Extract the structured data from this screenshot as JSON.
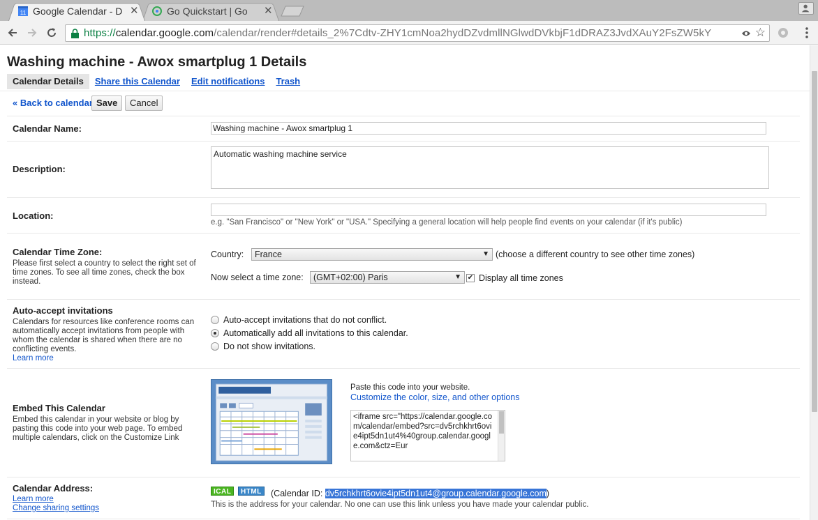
{
  "browser": {
    "tabs": [
      {
        "title": "Google Calendar - D",
        "active": true
      },
      {
        "title": "Go Quickstart  |  Go",
        "active": false
      }
    ],
    "url": {
      "scheme": "https://",
      "host": "calendar.google.com",
      "path": "/calendar/render#details_2%7Cdtv-ZHY1cmNoa2hydDZvdmllNGlwdDVkbjF1dDRAZ3JvdXAuY2FsZW5kY"
    }
  },
  "page": {
    "title": "Washing machine - Awox smartplug 1 Details",
    "tabs": [
      "Calendar Details",
      "Share this Calendar",
      "Edit notifications",
      "Trash"
    ],
    "back_link": "« Back to calendar",
    "save_label": "Save",
    "cancel_label": "Cancel"
  },
  "fields": {
    "name": {
      "label": "Calendar Name:",
      "value": "Washing machine - Awox smartplug 1"
    },
    "description": {
      "label": "Description:",
      "value": "Automatic washing machine service"
    },
    "location": {
      "label": "Location:",
      "value": "",
      "hint": "e.g. \"San Francisco\" or \"New York\" or \"USA.\" Specifying a general location will help people find events on your calendar (if it's public)"
    },
    "timezone": {
      "label": "Calendar Time Zone:",
      "desc": "Please first select a country to select the right set of time zones. To see all time zones, check the box instead.",
      "country_label": "Country:",
      "country_value": "France",
      "country_note": "(choose a different country to see other time zones)",
      "tz_label": "Now select a time zone:",
      "tz_value": "(GMT+02:00) Paris",
      "all_tz_label": "Display all time zones",
      "all_tz_checked": true
    },
    "auto_accept": {
      "label": "Auto-accept invitations",
      "desc": "Calendars for resources like conference rooms can automatically accept invitations from people with whom the calendar is shared when there are no conflicting events.",
      "learn_more": "Learn more",
      "options": [
        "Auto-accept invitations that do not conflict.",
        "Automatically add all invitations to this calendar.",
        "Do not show invitations."
      ],
      "selected_index": 1
    },
    "embed": {
      "label": "Embed This Calendar",
      "desc": "Embed this calendar in your website or blog by pasting this code into your web page. To embed multiple calendars, click on the Customize Link",
      "paste_text": "Paste this code into your website.",
      "customize_link": "Customize the color, size, and other options",
      "code": "<iframe src=\"https://calendar.google.com/calendar/embed?src=dv5rchkhrt6ovie4ipt5dn1ut4%40group.calendar.google.com&ctz=Eur"
    },
    "address": {
      "label": "Calendar Address:",
      "learn_more": "Learn more",
      "change_sharing": "Change sharing settings",
      "ical_badge": "ICAL",
      "html_badge": "HTML",
      "calendar_id_prefix": "(Calendar ID: ",
      "calendar_id": "dv5rchkhrt6ovie4ipt5dn1ut4@group.calendar.google.com",
      "calendar_id_suffix": ")",
      "note": "This is the address for your calendar. No one can use this link unless you have made your calendar public."
    }
  },
  "colors": {
    "link": "#1155cc",
    "selection": "#3875d7",
    "ical": "#4bb521",
    "html": "#3b87c8"
  }
}
